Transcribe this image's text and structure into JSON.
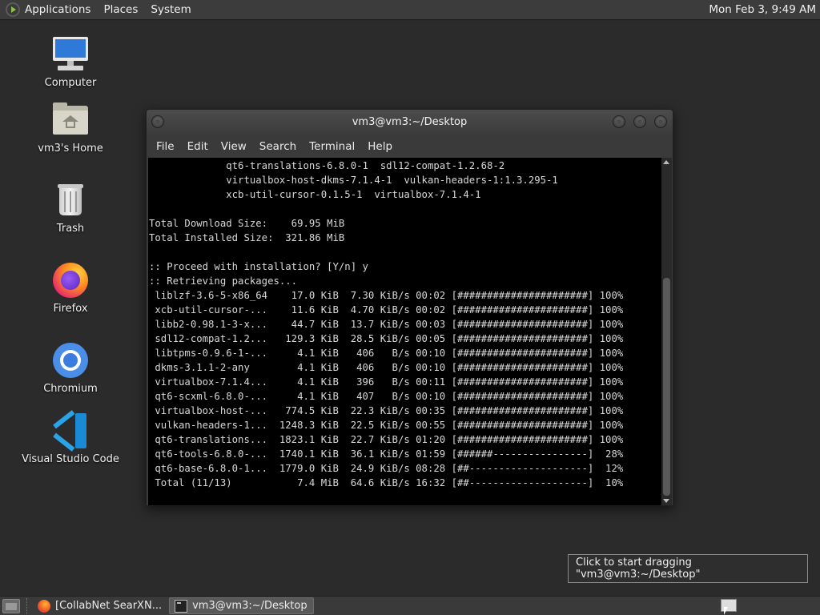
{
  "top_panel": {
    "menus": [
      "Applications",
      "Places",
      "System"
    ],
    "clock": "Mon Feb  3,  9:49 AM"
  },
  "desktop_icons": [
    {
      "label": "Computer",
      "icon": "computer-icon"
    },
    {
      "label": "vm3's Home",
      "icon": "home-folder-icon"
    },
    {
      "label": "Trash",
      "icon": "trash-icon"
    },
    {
      "label": "Firefox",
      "icon": "firefox-icon"
    },
    {
      "label": "Chromium",
      "icon": "chromium-icon"
    },
    {
      "label": "Visual Studio Code",
      "icon": "vscode-icon"
    }
  ],
  "terminal": {
    "title": "vm3@vm3:~/Desktop",
    "menus": [
      "File",
      "Edit",
      "View",
      "Search",
      "Terminal",
      "Help"
    ],
    "lines": [
      "             qt6-translations-6.8.0-1  sdl12-compat-1.2.68-2",
      "             virtualbox-host-dkms-7.1.4-1  vulkan-headers-1:1.3.295-1",
      "             xcb-util-cursor-0.1.5-1  virtualbox-7.1.4-1",
      "",
      "Total Download Size:    69.95 MiB",
      "Total Installed Size:  321.86 MiB",
      "",
      ":: Proceed with installation? [Y/n] y",
      ":: Retrieving packages...",
      " liblzf-3.6-5-x86_64    17.0 KiB  7.30 KiB/s 00:02 [######################] 100%",
      " xcb-util-cursor-...    11.6 KiB  4.70 KiB/s 00:02 [######################] 100%",
      " libb2-0.98.1-3-x...    44.7 KiB  13.7 KiB/s 00:03 [######################] 100%",
      " sdl12-compat-1.2...   129.3 KiB  28.5 KiB/s 00:05 [######################] 100%",
      " libtpms-0.9.6-1-...     4.1 KiB   406   B/s 00:10 [######################] 100%",
      " dkms-3.1.1-2-any        4.1 KiB   406   B/s 00:10 [######################] 100%",
      " virtualbox-7.1.4...     4.1 KiB   396   B/s 00:11 [######################] 100%",
      " qt6-scxml-6.8.0-...     4.1 KiB   407   B/s 00:10 [######################] 100%",
      " virtualbox-host-...   774.5 KiB  22.3 KiB/s 00:35 [######################] 100%",
      " vulkan-headers-1...  1248.3 KiB  22.5 KiB/s 00:55 [######################] 100%",
      " qt6-translations...  1823.1 KiB  22.7 KiB/s 01:20 [######################] 100%",
      " qt6-tools-6.8.0-...  1740.1 KiB  36.1 KiB/s 01:59 [######----------------]  28%",
      " qt6-base-6.8.0-1...  1779.0 KiB  24.9 KiB/s 08:28 [##--------------------]  12%",
      " Total (11/13)           7.4 MiB  64.6 KiB/s 16:32 [##--------------------]  10%"
    ]
  },
  "tooltip": "Click to start dragging \"vm3@vm3:~/Desktop\"",
  "taskbar": {
    "tasks": [
      {
        "label": "[CollabNet SearXN...",
        "icon": "firefox-icon",
        "active": false
      },
      {
        "label": "vm3@vm3:~/Desktop",
        "icon": "terminal-icon",
        "active": true
      }
    ]
  }
}
